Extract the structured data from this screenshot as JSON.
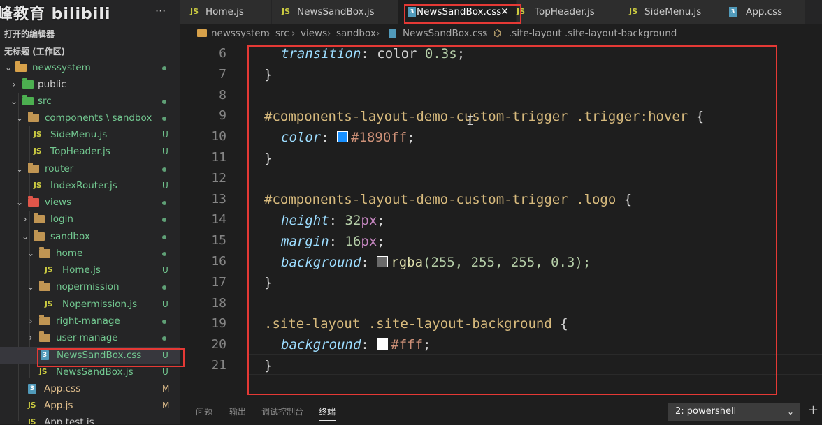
{
  "watermark": "峰教育 bilibili",
  "sidebar": {
    "more": "···",
    "open_editors": "打开的编辑器",
    "workspace": "无标题 (工作区)",
    "tree": [
      {
        "label": "newssystem",
        "icon": "project-folder",
        "status": "dot"
      },
      {
        "label": "public",
        "icon": "folder-green",
        "status": ""
      },
      {
        "label": "src",
        "icon": "folder-green",
        "status": "dot"
      },
      {
        "label": "components \\ sandbox",
        "icon": "folder",
        "status": "dot"
      },
      {
        "label": "SideMenu.js",
        "icon": "js",
        "status": "U"
      },
      {
        "label": "TopHeader.js",
        "icon": "js",
        "status": "U"
      },
      {
        "label": "router",
        "icon": "folder",
        "status": "dot"
      },
      {
        "label": "IndexRouter.js",
        "icon": "js",
        "status": "U"
      },
      {
        "label": "views",
        "icon": "folder-red",
        "status": "dot"
      },
      {
        "label": "login",
        "icon": "folder",
        "status": "dot"
      },
      {
        "label": "sandbox",
        "icon": "folder",
        "status": "dot"
      },
      {
        "label": "home",
        "icon": "folder",
        "status": "dot"
      },
      {
        "label": "Home.js",
        "icon": "js",
        "status": "U"
      },
      {
        "label": "nopermission",
        "icon": "folder",
        "status": "dot"
      },
      {
        "label": "Nopermission.js",
        "icon": "js",
        "status": "U"
      },
      {
        "label": "right-manage",
        "icon": "folder",
        "status": "dot"
      },
      {
        "label": "user-manage",
        "icon": "folder",
        "status": "dot"
      },
      {
        "label": "NewsSandBox.css",
        "icon": "css",
        "status": "U"
      },
      {
        "label": "NewsSandBox.js",
        "icon": "js",
        "status": "U"
      },
      {
        "label": "App.css",
        "icon": "css",
        "status": "M"
      },
      {
        "label": "App.js",
        "icon": "js",
        "status": "M"
      },
      {
        "label": "App.test.js",
        "icon": "js",
        "status": ""
      }
    ]
  },
  "tabs": [
    {
      "label": "Home.js",
      "icon": "js"
    },
    {
      "label": "NewsSandBox.js",
      "icon": "js"
    },
    {
      "label": "NewsSandBox.css",
      "icon": "css",
      "active": true,
      "close": "✕"
    },
    {
      "label": "TopHeader.js",
      "icon": "js"
    },
    {
      "label": "SideMenu.js",
      "icon": "js"
    },
    {
      "label": "App.css",
      "icon": "css"
    }
  ],
  "breadcrumb": {
    "items": [
      "newssystem",
      "src",
      "views",
      "sandbox",
      "NewsSandBox.css",
      ".site-layout .site-layout-background"
    ],
    "sep": "›"
  },
  "editor": {
    "line_numbers": [
      "6",
      "7",
      "8",
      "9",
      "10",
      "11",
      "12",
      "13",
      "14",
      "15",
      "16",
      "17",
      "18",
      "19",
      "20",
      "21"
    ],
    "l6_prop": "transition",
    "l6_colon": ": ",
    "l6_val": "color ",
    "l6_num": "0.3",
    "l6_unit": "s",
    "l6_semi": ";",
    "l7": "}",
    "l9_sel": "#components-layout-demo-custom-trigger .trigger:hover",
    "l9_brace": " {",
    "l10_prop": "color",
    "l10_colon": ": ",
    "l10_swatch": "#1890ff",
    "l10_val": "#1890ff",
    "l10_semi": ";",
    "l11": "}",
    "l13_sel": "#components-layout-demo-custom-trigger .logo",
    "l13_brace": " {",
    "l14_prop": "height",
    "l14_colon": ": ",
    "l14_num": "32",
    "l14_unit": "px",
    "l14_semi": ";",
    "l15_prop": "margin",
    "l15_colon": ": ",
    "l15_num": "16",
    "l15_unit": "px",
    "l15_semi": ";",
    "l16_prop": "background",
    "l16_colon": ": ",
    "l16_swatch": "rgba(255,255,255,0.3)",
    "l16_fn": "rgba",
    "l16_args": "(255, 255, 255, 0.3);",
    "l17": "}",
    "l19_sel": ".site-layout .site-layout-background",
    "l19_brace": " {",
    "l20_prop": "background",
    "l20_colon": ": ",
    "l20_swatch": "#ffffff",
    "l20_val": "#fff",
    "l20_semi": ";",
    "l21": "}"
  },
  "panel": {
    "tabs": [
      "问题",
      "输出",
      "调试控制台",
      "终端"
    ],
    "active_tab": "终端",
    "terminal_select": "2: powershell",
    "chevron": "⌄",
    "plus": "+"
  },
  "colors": {
    "highlight_box": "#e53935",
    "accent_blue": "#1890ff"
  }
}
